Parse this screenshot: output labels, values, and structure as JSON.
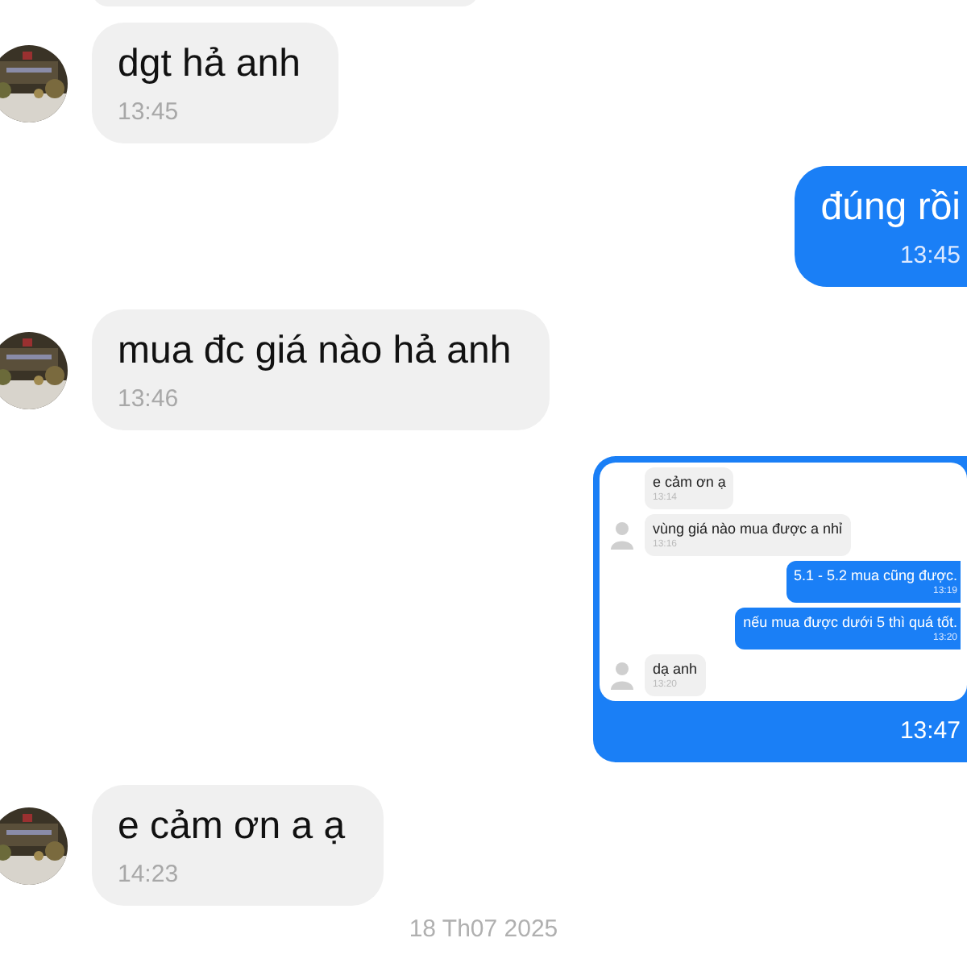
{
  "messages": [
    {
      "kind": "received",
      "text": "dgt hả anh",
      "time": "13:45"
    },
    {
      "kind": "sent",
      "text": "đúng rồi",
      "time": "13:45"
    },
    {
      "kind": "received",
      "text": "mua đc giá nào hả anh",
      "time": "13:46"
    },
    {
      "kind": "sent_image",
      "time": "13:47",
      "screenshot": [
        {
          "kind": "received",
          "avatar": false,
          "text": "e cảm ơn ạ",
          "time": "13:14"
        },
        {
          "kind": "received",
          "avatar": true,
          "text": "vùng giá nào mua được a nhỉ",
          "time": "13:16"
        },
        {
          "kind": "sent",
          "text": "5.1 - 5.2 mua cũng được.",
          "time": "13:19"
        },
        {
          "kind": "sent",
          "text": "nếu mua được dưới 5 thì quá tốt.",
          "time": "13:20"
        },
        {
          "kind": "received",
          "avatar": true,
          "text": "dạ anh",
          "time": "13:20"
        }
      ]
    },
    {
      "kind": "received",
      "text": "e cảm ơn a ạ",
      "time": "14:23"
    }
  ],
  "date_separator": "18 Th07 2025"
}
